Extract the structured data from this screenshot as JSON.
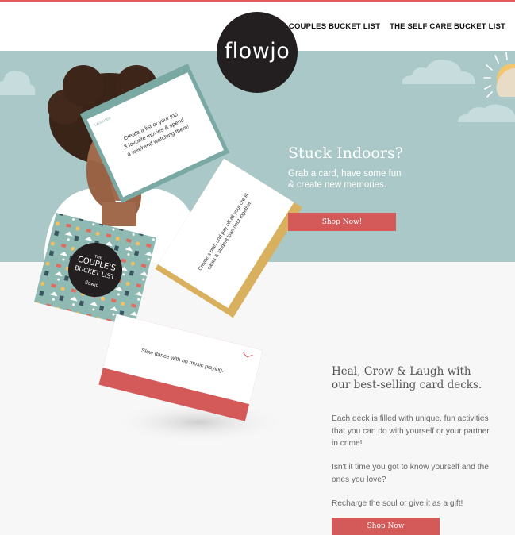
{
  "brand": {
    "logo_text": "flowjo",
    "accent_color": "#d45a5a",
    "hero_bg": "#a9c8c7"
  },
  "nav": {
    "items": [
      "THE COUPLES BUCKET LIST",
      "THE SELF CARE BUCKET LIST"
    ]
  },
  "hero": {
    "title": "Stuck Indoors?",
    "subtitle": "Grab a card, have some fun & create new memories.",
    "cta_label": "Shop Now!"
  },
  "cards": {
    "teal_card_text": "Create a list of your top 3 favorite movies & spend a weekend watching them!",
    "teal_card_tag": "LAUGHTER",
    "gold_card_text": "Create a plan and pay off all your credit cards & student loan debt together.",
    "red_card_text": "Slow dance with no music playing.",
    "deck_box_line1": "THE",
    "deck_box_line2": "COUPLE'S",
    "deck_box_line3": "BUCKET LIST",
    "deck_box_brand": "flowjo"
  },
  "section": {
    "title": "Heal, Grow & Laugh with our best-selling card decks.",
    "paragraph1": "Each deck is filled with unique, fun activities that you can do with yourself or your partner in crime!",
    "paragraph2": "Isn't it time you got to know yourself and the ones you love?",
    "paragraph3": "Recharge the soul or give it as a gift!",
    "cta_label": "Shop Now"
  }
}
